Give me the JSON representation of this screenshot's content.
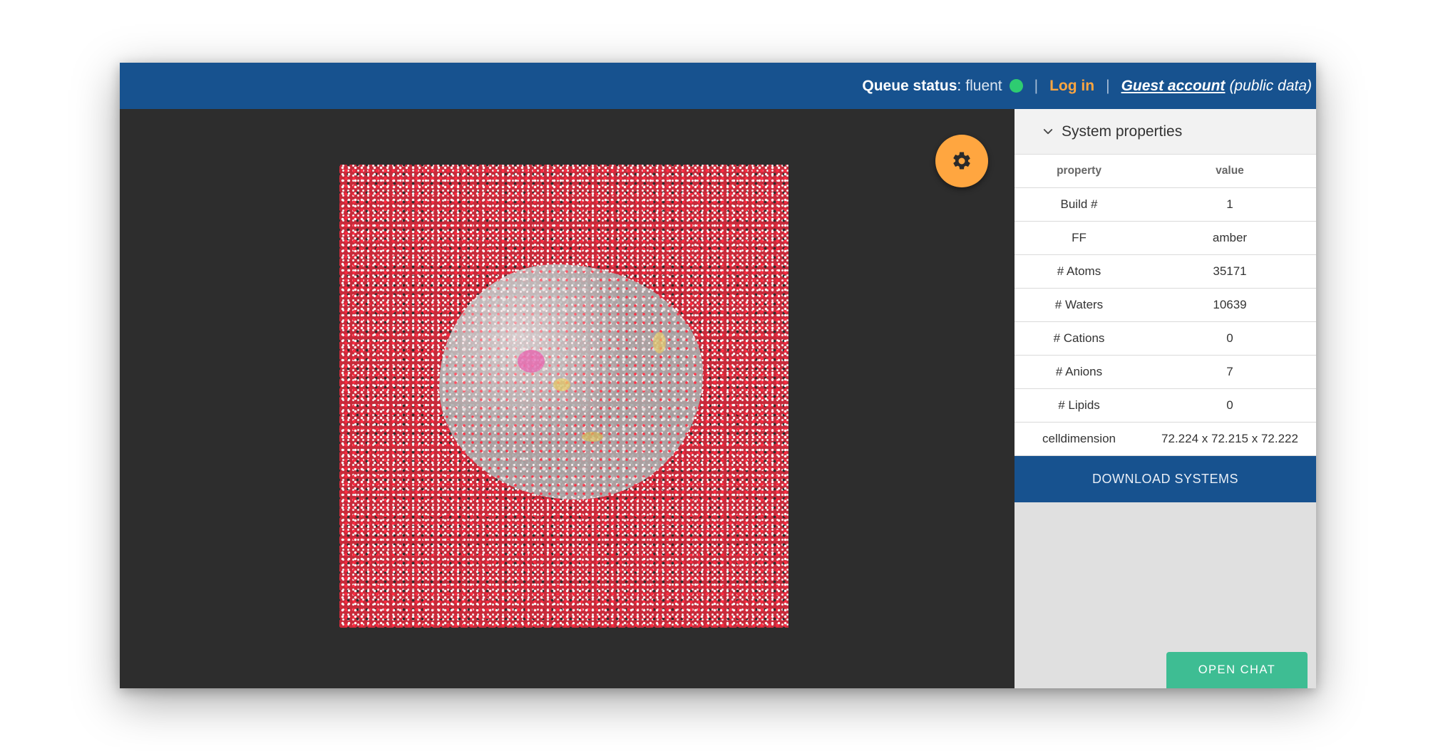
{
  "header": {
    "queue_label": "Queue status",
    "queue_colon": ":",
    "queue_value": "fluent",
    "status_color": "#2ecc71",
    "separator": "|",
    "login_label": "Log in",
    "guest_label": "Guest account",
    "guest_note": "(public data)"
  },
  "viewer": {
    "settings_icon": "gear-icon",
    "accent": "#ffa640"
  },
  "panel": {
    "title": "System properties",
    "columns": [
      "property",
      "value"
    ],
    "rows": [
      {
        "property": "Build #",
        "value": "1"
      },
      {
        "property": "FF",
        "value": "amber"
      },
      {
        "property": "# Atoms",
        "value": "35171"
      },
      {
        "property": "# Waters",
        "value": "10639"
      },
      {
        "property": "# Cations",
        "value": "0"
      },
      {
        "property": "# Anions",
        "value": "7"
      },
      {
        "property": "# Lipids",
        "value": "0"
      },
      {
        "property": "celldimension",
        "value": "72.224 x 72.215 x 72.222"
      }
    ],
    "download_label": "DOWNLOAD SYSTEMS"
  },
  "chat": {
    "label": "OPEN CHAT",
    "color": "#3ebd93"
  }
}
